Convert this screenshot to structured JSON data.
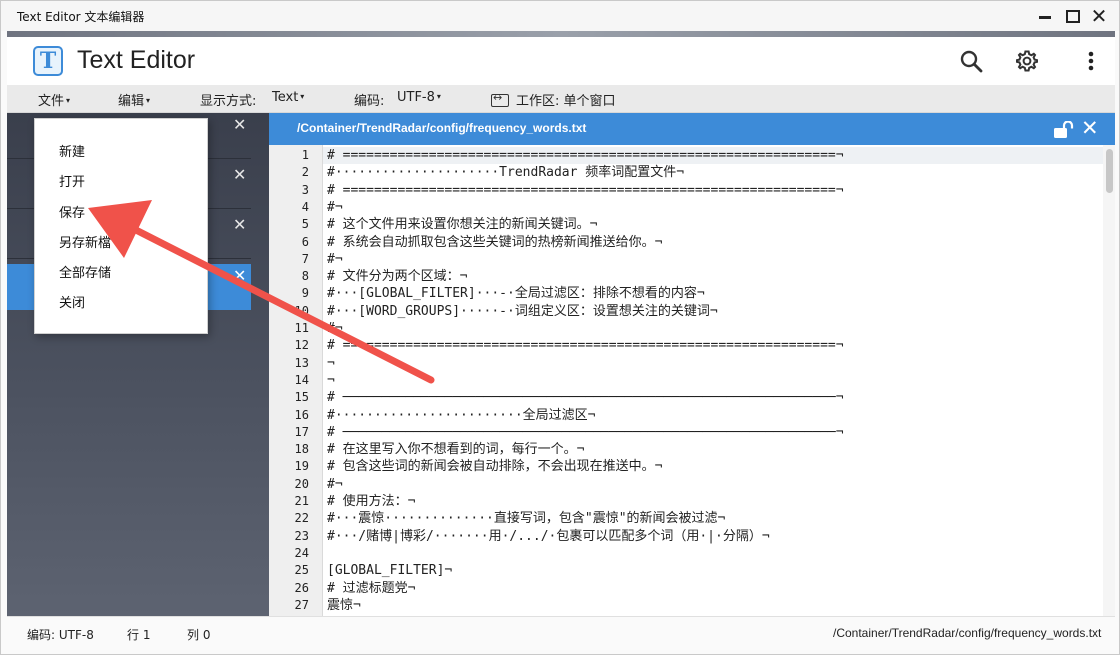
{
  "window": {
    "title": "Text Editor 文本编辑器",
    "controls": {
      "close": "✕"
    }
  },
  "header": {
    "logo_letter": "T",
    "app_title": "Text Editor",
    "icons": [
      "search-icon",
      "gear-icon",
      "more-vert-icon"
    ]
  },
  "menubar": {
    "file": "文件",
    "edit": "编辑",
    "view_label": "显示方式:",
    "view_value": "Text",
    "encoding_label": "编码:",
    "encoding_value": "UTF-8",
    "caret": "▾",
    "workspace": "工作区: 单个窗口"
  },
  "file_menu": {
    "items": [
      "新建",
      "打开",
      "保存",
      "另存新檔",
      "全部存储",
      "关闭"
    ]
  },
  "sidebar": {
    "tab_close": "✕",
    "tab_count": 4,
    "active_tab_index": 3
  },
  "editor": {
    "path": "/Container/TrendRadar/config/frequency_words.txt",
    "close": "✕",
    "lines": [
      "# ===============================================================¬",
      "#·····················TrendRadar 频率词配置文件¬",
      "# ===============================================================¬",
      "#¬",
      "# 这个文件用来设置你想关注的新闻关键词。¬",
      "# 系统会自动抓取包含这些关键词的热榜新闻推送给你。¬",
      "#¬",
      "# 文件分为两个区域：¬",
      "#···[GLOBAL_FILTER]···-·全局过滤区：排除不想看的内容¬",
      "#···[WORD_GROUPS]·····-·词组定义区：设置想关注的关键词¬",
      "#¬",
      "# ===============================================================¬",
      "¬",
      "¬",
      "# ───────────────────────────────────────────────────────────────¬",
      "#························全局过滤区¬",
      "# ───────────────────────────────────────────────────────────────¬",
      "# 在这里写入你不想看到的词，每行一个。¬",
      "# 包含这些词的新闻会被自动排除，不会出现在推送中。¬",
      "#¬",
      "# 使用方法：¬",
      "#···震惊··············直接写词，包含\"震惊\"的新闻会被过滤¬",
      "#···/赌博|博彩/·······用·/.../·包裹可以匹配多个词（用·|·分隔）¬",
      "",
      "[GLOBAL_FILTER]¬",
      "# 过滤标题党¬",
      "震惊¬"
    ]
  },
  "statusbar": {
    "encoding": "编码: UTF-8",
    "row": "行 1",
    "col": "列 0",
    "path": "/Container/TrendRadar/config/frequency_words.txt"
  },
  "annotation": {
    "arrow_color": "#f0524a",
    "points_to": "保存"
  }
}
